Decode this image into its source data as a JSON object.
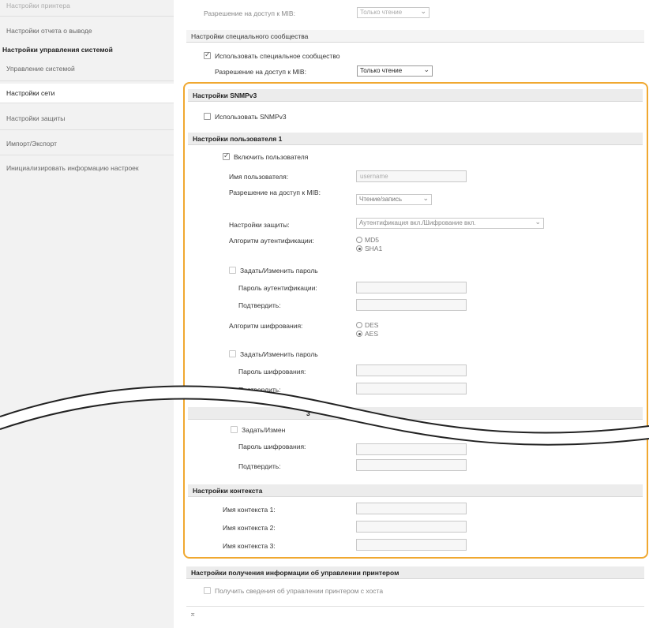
{
  "sidebar": {
    "items": [
      {
        "label": "Настройки принтера"
      },
      {
        "label": "Настройки отчета о выводе"
      },
      {
        "label": "Настройки управления системой"
      },
      {
        "label": "Управление системой"
      },
      {
        "label": "Настройки сети"
      },
      {
        "label": "Настройки защиты"
      },
      {
        "label": "Импорт/Экспорт"
      },
      {
        "label": "Инициализировать информацию настроек"
      }
    ]
  },
  "top": {
    "mib_access_label_dim": "Разрешение на доступ к MIB:",
    "mib_access_value_dim": "Только чтение",
    "special_community_title": "Настройки специального сообщества",
    "use_special_community": "Использовать специальное сообщество",
    "mib_access_label": "Разрешение на доступ к MIB:",
    "mib_access_value": "Только чтение"
  },
  "snmpv3": {
    "title": "Настройки SNMPv3",
    "use_snmpv3": "Использовать SNMPv3"
  },
  "user1": {
    "title": "Настройки пользователя 1",
    "enable_user": "Включить пользователя",
    "username_label": "Имя пользователя:",
    "username_value": "username",
    "mib_access_label": "Разрешение на доступ к MIB:",
    "mib_access_value": "Чтение/запись",
    "security_label": "Настройки защиты:",
    "security_value": "Аутентификация вкл./Шифрование вкл.",
    "auth_algo_label": "Алгоритм аутентификации:",
    "auth_md5": "MD5",
    "auth_sha1": "SHA1",
    "set_change_password": "Задать/Изменить пароль",
    "auth_password_label": "Пароль аутентификации:",
    "confirm_label": "Подтвердить:",
    "enc_algo_label": "Алгоритм шифрования:",
    "enc_des": "DES",
    "enc_aes": "AES",
    "set_change_password_2": "Задать/Изменить пароль",
    "enc_password_label": "Пароль шифрования:",
    "confirm_label_2": "Подтвердить:"
  },
  "after_break": {
    "partial_title": "3",
    "set_change_partial": "Задать/Измен",
    "enc_password_label": "Пароль шифрования:",
    "confirm_label": "Подтвердить:"
  },
  "context": {
    "title": "Настройки контекста",
    "name1": "Имя контекста 1:",
    "name2": "Имя контекста 2:",
    "name3": "Имя контекста 3:"
  },
  "printer_mgmt": {
    "title": "Настройки получения информации об управлении принтером",
    "get_info": "Получить сведения об управлении принтером с хоста"
  },
  "footer": {
    "top_link": "⌅"
  },
  "colors": {
    "highlight": "#f0a830",
    "sidebar_bg": "#f2f2f2",
    "section_bg": "#ececec"
  }
}
